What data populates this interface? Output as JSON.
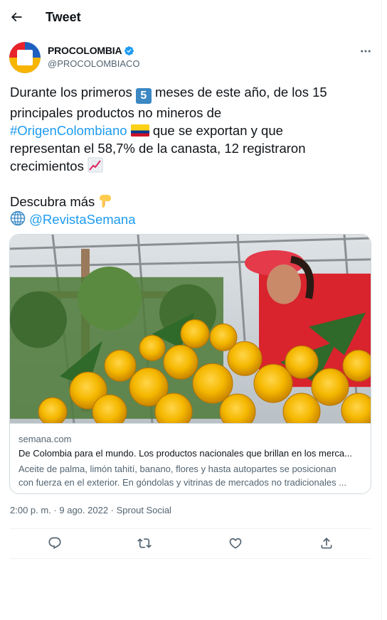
{
  "header": {
    "title": "Tweet"
  },
  "author": {
    "name": "PROCOLOMBIA",
    "handle": "@PROCOLOMBIACO",
    "verified": true,
    "avatar_colors": [
      "#f7b500",
      "#e8232a",
      "#1f5fbf"
    ]
  },
  "tweet": {
    "line1_before": "Durante los primeros ",
    "keycap": "5",
    "line1_after": " meses de este año, de los 15",
    "line2": "principales productos no mineros de",
    "hashtag": "#OrigenColombiano",
    "line3_after": " que se exportan y que",
    "line4": "representan el 58,7% de la canasta, 12 registraron",
    "line5": "crecimientos",
    "line6": "Descubra más",
    "mention": "@RevistaSemana",
    "emojis": [
      "keycap-5",
      "colombia-flag",
      "chart-increasing",
      "backhand-index-pointing-down",
      "globe-with-meridians"
    ]
  },
  "card": {
    "domain": "semana.com",
    "title": "De Colombia para el mundo. Los productos nacionales que brillan en los merca...",
    "desc_line1": "Aceite de palma, limón tahití, banano, flores y hasta autopartes se posicionan",
    "desc_line2": "con fuerza en el exterior. En góndolas y vitrinas de mercados no tradicionales ...",
    "image_subject": "worker-with-yellow-roses"
  },
  "meta": {
    "time": "2:00 p. m.",
    "sep1": " · ",
    "date": "9 ago. 2022",
    "sep2": " · ",
    "source": "Sprout Social"
  },
  "actions": [
    "reply-icon",
    "retweet-icon",
    "like-icon",
    "share-icon"
  ],
  "colors": {
    "accent": "#1d9bf0",
    "text": "#0f1419",
    "secondary": "#536471",
    "border": "#cfd9de"
  }
}
